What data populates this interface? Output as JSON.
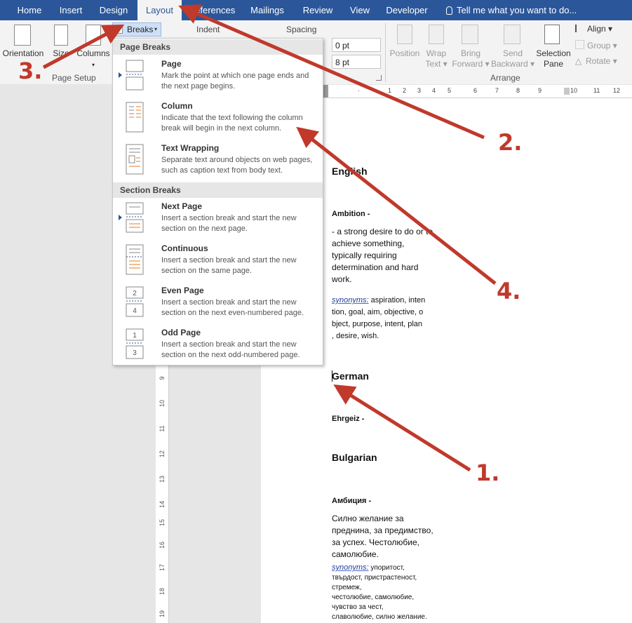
{
  "tabs": [
    "Home",
    "Insert",
    "Design",
    "Layout",
    "References",
    "Mailings",
    "Review",
    "View",
    "Developer"
  ],
  "active_tab": "Layout",
  "tell_me": "Tell me what you want to do...",
  "ribbon": {
    "page_setup": {
      "orientation": "Orientation",
      "size": "Size",
      "columns": "Columns",
      "breaks": "Breaks",
      "group_label": "Page Setup"
    },
    "paragraph": {
      "indent_label": "Indent",
      "spacing_label": "Spacing",
      "before_value": "0 pt",
      "after_value": "8 pt"
    },
    "arrange": {
      "position": "Position",
      "wrap_text_1": "Wrap",
      "wrap_text_2": "Text",
      "bring_forward_1": "Bring",
      "bring_forward_2": "Forward",
      "send_backward_1": "Send",
      "send_backward_2": "Backward",
      "selection_pane_1": "Selection",
      "selection_pane_2": "Pane",
      "align": "Align",
      "group": "Group",
      "rotate": "Rotate",
      "group_label": "Arrange"
    }
  },
  "breaks_menu": {
    "page_breaks_header": "Page Breaks",
    "section_breaks_header": "Section Breaks",
    "items": [
      {
        "title": "Page",
        "desc": "Mark the point at which one page ends and the next page begins."
      },
      {
        "title": "Column",
        "desc": "Indicate that the text following the column break will begin in the next column."
      },
      {
        "title": "Text Wrapping",
        "desc": "Separate text around objects on web pages, such as caption text from body text."
      },
      {
        "title": "Next Page",
        "desc": "Insert a section break and start the new section on the next page."
      },
      {
        "title": "Continuous",
        "desc": "Insert a section break and start the new section on the same page."
      },
      {
        "title": "Even Page",
        "desc": "Insert a section break and start the new section on the next even-numbered page."
      },
      {
        "title": "Odd Page",
        "desc": "Insert a section break and start the new section on the next odd-numbered page."
      }
    ]
  },
  "document": {
    "english_heading": "English",
    "ambition_label": "Ambition -",
    "ambition_def": [
      "- a strong desire to do or to",
      "achieve something,",
      "typically requiring",
      "determination and hard",
      "work."
    ],
    "synonyms_label": "synonyms:",
    "synonyms_en": [
      " aspiration, inten",
      "tion, goal, aim, objective, o",
      "bject, purpose, intent, plan",
      ", desire, wish."
    ],
    "german_heading": "German",
    "german_word": "Ehrgeiz -",
    "bulgarian_heading": "Bulgarian",
    "bulgarian_word": "Амбиция -",
    "bulgarian_def": [
      "Силно желание за",
      "преднина, за предимство,",
      "за успех. Честолюбие,",
      "самолюбие."
    ],
    "synonyms_bg": [
      " упоритост,",
      "твърдост, пристрастеност,",
      "стремеж,",
      "честолюбие, самолюбие,",
      "чувство за чест,",
      "славолюбие, силно желание."
    ]
  },
  "annotations": [
    "1.",
    "2.",
    "3.",
    "4."
  ],
  "colors": {
    "accent": "#2b579a",
    "annotation": "#c0392b"
  },
  "ruler_h": [
    "1",
    "2",
    "3",
    "4",
    "5",
    "6",
    "7",
    "8",
    "9",
    "10",
    "11",
    "12"
  ],
  "ruler_v": [
    "9",
    "10",
    "11",
    "12",
    "13",
    "14",
    "15",
    "16",
    "17",
    "18",
    "19"
  ]
}
